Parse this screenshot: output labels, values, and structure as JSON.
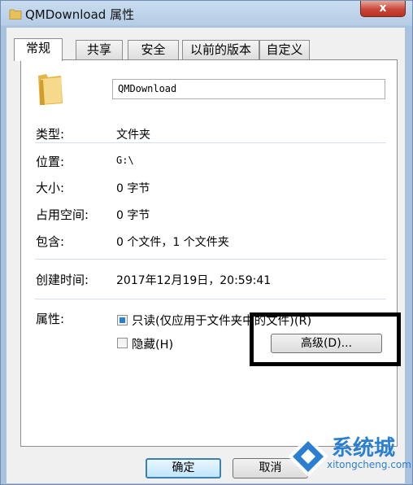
{
  "window": {
    "title": "QMDownload 属性",
    "close_label": "x"
  },
  "tabs": [
    {
      "label": "常规",
      "active": true
    },
    {
      "label": "共享",
      "active": false
    },
    {
      "label": "安全",
      "active": false
    },
    {
      "label": "以前的版本",
      "active": false
    },
    {
      "label": "自定义",
      "active": false
    }
  ],
  "general": {
    "folder_name": "QMDownload",
    "fields": [
      {
        "label": "类型:",
        "value": "文件夹"
      },
      {
        "label": "位置:",
        "value": "G:\\"
      },
      {
        "label": "大小:",
        "value": "0 字节"
      },
      {
        "label": "占用空间:",
        "value": "0 字节"
      },
      {
        "label": "包含:",
        "value": "0 个文件，1 个文件夹"
      }
    ],
    "created_label": "创建时间:",
    "created_value": "2017年12月19日，20:59:41",
    "attributes_label": "属性:",
    "readonly_label": "只读(仅应用于文件夹中的文件)(R)",
    "readonly_checked": true,
    "hidden_label": "隐藏(H)",
    "hidden_checked": false,
    "advanced_label": "高级(D)..."
  },
  "buttons": {
    "ok": "确定",
    "cancel": "取消"
  },
  "watermark": {
    "brand": "系统城",
    "url": "xitongcheng.com"
  },
  "colors": {
    "accent": "#2b7fd1",
    "close": "#c9473a"
  }
}
